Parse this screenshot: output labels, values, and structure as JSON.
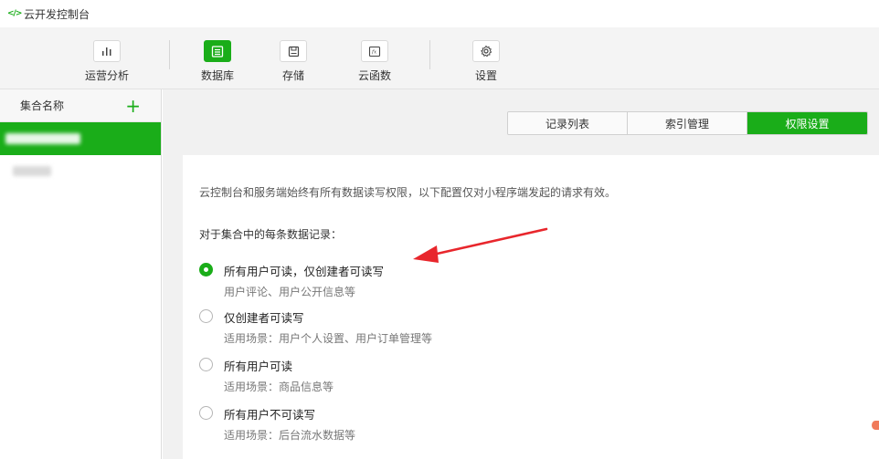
{
  "window": {
    "title": "云开发控制台",
    "logo": "</>"
  },
  "toolbar": {
    "items": [
      {
        "label": "运营分析",
        "icon": "bar-chart-icon"
      },
      {
        "label": "数据库",
        "icon": "database-icon"
      },
      {
        "label": "存储",
        "icon": "storage-icon"
      },
      {
        "label": "云函数",
        "icon": "function-icon"
      },
      {
        "label": "设置",
        "icon": "gear-icon"
      }
    ],
    "active": "数据库"
  },
  "sidebar": {
    "header": "集合名称",
    "add_icon": "plus-icon"
  },
  "tabs": [
    {
      "label": "记录列表"
    },
    {
      "label": "索引管理"
    },
    {
      "label": "权限设置"
    }
  ],
  "active_tab": "权限设置",
  "permissions": {
    "description": "云控制台和服务端始终有所有数据读写权限，以下配置仅对小程序端发起的请求有效。",
    "subtitle": "对于集合中的每条数据记录：",
    "options": [
      {
        "title": "所有用户可读，仅创建者可读写",
        "subtitle": "用户评论、用户公开信息等",
        "checked": true
      },
      {
        "title": "仅创建者可读写",
        "subtitle": "适用场景：用户个人设置、用户订单管理等",
        "checked": false
      },
      {
        "title": "所有用户可读",
        "subtitle": "适用场景：商品信息等",
        "checked": false
      },
      {
        "title": "所有用户不可读写",
        "subtitle": "适用场景：后台流水数据等",
        "checked": false
      }
    ]
  },
  "colors": {
    "accent": "#1aad19",
    "arrow": "#e8262c"
  }
}
